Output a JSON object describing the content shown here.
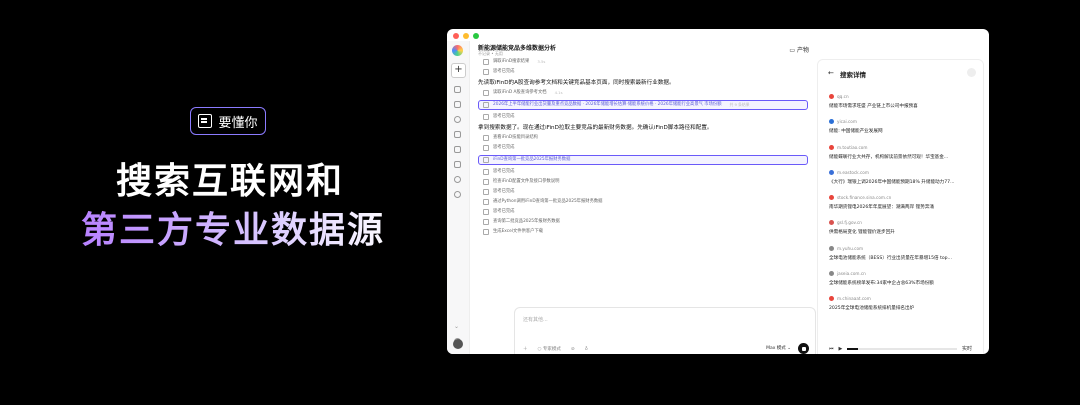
{
  "promo": {
    "badge_label": "要懂你",
    "headline_line1": "搜索互联网和",
    "headline_line2": "第三方专业数据源"
  },
  "window": {
    "title": "新能源储能竞品多维数据分析",
    "subtitle": "不记录 • 无用",
    "artifact_label": "产物"
  },
  "steps": [
    {
      "kind": "item",
      "text": "调取iFinD搜索结果",
      "meta": "3.5s"
    },
    {
      "kind": "item",
      "text": "思考已完成",
      "meta": ""
    },
    {
      "kind": "heading",
      "text": "先读取iFinD的A股查询参考文档和关键竞品基本页面，同时搜索最新行业数据。",
      "meta": ""
    },
    {
      "kind": "item",
      "text": "读取iFinD A股查询参考文档",
      "meta": "4.1s"
    },
    {
      "kind": "hl",
      "text": "2026年上半年储能行业出货量及重点竞品数据 · 2026年储能增长估算·储能系统价格 · 2026年储能行业高景气 市场份额",
      "meta": "共 9 条结果"
    },
    {
      "kind": "item",
      "text": "思考已完成",
      "meta": ""
    },
    {
      "kind": "heading",
      "text": "拿到搜索数据了。现在通过iFinD拉取主要竞品的最新财务数据。先确认iFinD脚本路径和配置。",
      "meta": ""
    },
    {
      "kind": "item",
      "text": "查看iFinD技能目录结构",
      "meta": ""
    },
    {
      "kind": "item",
      "text": "思考已完成",
      "meta": ""
    },
    {
      "kind": "hl",
      "text": "iFinD查询第一批竞品2025年报财务数据",
      "meta": ""
    },
    {
      "kind": "item",
      "text": "思考已完成",
      "meta": ""
    },
    {
      "kind": "item",
      "text": "检查iFinD配置文件及接口参数说明",
      "meta": ""
    },
    {
      "kind": "item",
      "text": "思考已完成",
      "meta": ""
    },
    {
      "kind": "item",
      "text": "通过Python调用iFinD查询第一批竞品2025年报财务数据",
      "meta": ""
    },
    {
      "kind": "item",
      "text": "思考已完成",
      "meta": ""
    },
    {
      "kind": "item",
      "text": "查询第二批竞品2025年报财务数据",
      "meta": ""
    },
    {
      "kind": "item",
      "text": "生成Excel文件供客户下载",
      "meta": ""
    }
  ],
  "composer": {
    "placeholder": "还有其他...",
    "tool_expert": "专家模式",
    "mode_label": "Max 模式"
  },
  "panel": {
    "back_icon": "←",
    "title": "搜索详情",
    "results": [
      {
        "domain": "qq.cn",
        "title": "储能市场需求旺盛 产业链上市公司中报预喜",
        "color": "#e8453c"
      },
      {
        "domain": "yicai.com",
        "title": "储能: 中国储能产业发展网",
        "color": "#2b6fd6"
      },
      {
        "domain": "m.toutiao.com",
        "title": "储能蝶联行业大共存，机构解读前景依然可观！华宝基金...",
        "color": "#e8453c"
      },
      {
        "domain": "m.eastock.com",
        "title": "《大行》瑞银上调2026年中国储能预期18% 升储能动力77...",
        "color": "#3a6fd8"
      },
      {
        "domain": "stock.finance.sina.com.cn",
        "title": "南华期货锂电2026年年度展望：潮满两岸 锂势奔涌",
        "color": "#e8453c"
      },
      {
        "domain": "gsl.fj.gov.cn",
        "title": "供需格局变化 锂能锂价逐步回升",
        "color": "#d9534f"
      },
      {
        "domain": "m.yuhu.com",
        "title": "全球电池储能系统（BESS）行业出货量在年暴增15倍 top...",
        "color": "#888888"
      },
      {
        "domain": "jaseia.com.cn",
        "title": "全球储能系统榜单发布:34家中企占总63%市场份额",
        "color": "#888888"
      },
      {
        "domain": "m.chinaaat.com",
        "title": "2025年全球电池储能系统排机量排名出炉",
        "color": "#e8453c"
      }
    ],
    "playback_label": "实时",
    "progress": 0.1
  },
  "colors": {
    "accent": "#6a5af9"
  }
}
